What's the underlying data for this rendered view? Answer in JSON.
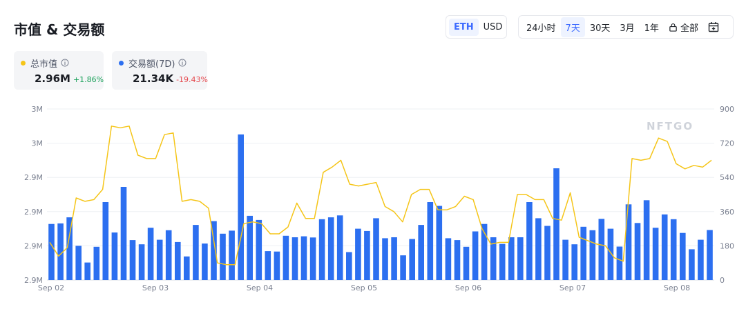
{
  "title": "市值 & 交易额",
  "currency": {
    "options": [
      "ETH",
      "USD"
    ],
    "selected": "ETH"
  },
  "periods": {
    "options": [
      "24小时",
      "7天",
      "30天",
      "3月",
      "1年"
    ],
    "all_label": "全部",
    "selected": "7天"
  },
  "cards": {
    "market_cap": {
      "label": "总市值",
      "value": "2.96M",
      "change": "+1.86%",
      "dot_color": "#f5c518"
    },
    "volume": {
      "label": "交易额(7D)",
      "value": "21.34K",
      "change": "-19.43%",
      "dot_color": "#2c6ff0"
    }
  },
  "watermark": "NFTGO",
  "colors": {
    "bar": "#2c6ff0",
    "line": "#f5c518",
    "up": "#18a058",
    "down": "#e5484d",
    "accent": "#3d6bff"
  },
  "chart_data": {
    "type": "bar",
    "x_tick_labels": [
      "Sep 02",
      "Sep 03",
      "Sep 04",
      "Sep 05",
      "Sep 06",
      "Sep 07",
      "Sep 08"
    ],
    "y_left_tick_labels": [
      "2.9M",
      "2.9M",
      "2.9M",
      "2.9M",
      "3M",
      "3M"
    ],
    "y_right_ticks": [
      0,
      180,
      360,
      540,
      720,
      900
    ],
    "y_right_range": [
      0,
      900
    ],
    "grid": "horizontal",
    "series": [
      {
        "type": "bar",
        "axis": "right",
        "values": [
          295,
          298,
          330,
          180,
          92,
          175,
          410,
          250,
          490,
          210,
          188,
          275,
          212,
          262,
          200,
          124,
          290,
          192,
          310,
          244,
          260,
          766,
          338,
          316,
          152,
          150,
          233,
          225,
          230,
          224,
          320,
          330,
          340,
          147,
          270,
          258,
          325,
          220,
          225,
          130,
          216,
          290,
          410,
          390,
          220,
          210,
          175,
          256,
          295,
          225,
          190,
          225,
          225,
          410,
          325,
          285,
          588,
          212,
          188,
          280,
          262,
          322,
          270,
          176,
          398,
          300,
          420,
          275,
          345,
          320,
          248,
          162,
          212,
          263
        ]
      },
      {
        "type": "line",
        "axis": "left",
        "values": [
          0.22,
          0.14,
          0.19,
          0.48,
          0.46,
          0.47,
          0.53,
          0.9,
          0.89,
          0.9,
          0.73,
          0.71,
          0.71,
          0.85,
          0.86,
          0.46,
          0.47,
          0.46,
          0.42,
          0.1,
          0.09,
          0.09,
          0.33,
          0.34,
          0.33,
          0.27,
          0.27,
          0.31,
          0.45,
          0.36,
          0.36,
          0.63,
          0.66,
          0.7,
          0.56,
          0.55,
          0.56,
          0.57,
          0.43,
          0.4,
          0.34,
          0.5,
          0.53,
          0.53,
          0.41,
          0.41,
          0.43,
          0.49,
          0.47,
          0.3,
          0.21,
          0.22,
          0.22,
          0.5,
          0.5,
          0.47,
          0.47,
          0.36,
          0.35,
          0.51,
          0.25,
          0.23,
          0.21,
          0.2,
          0.13,
          0.11,
          0.71,
          0.7,
          0.71,
          0.83,
          0.81,
          0.68,
          0.65,
          0.67,
          0.66,
          0.7
        ]
      }
    ]
  }
}
